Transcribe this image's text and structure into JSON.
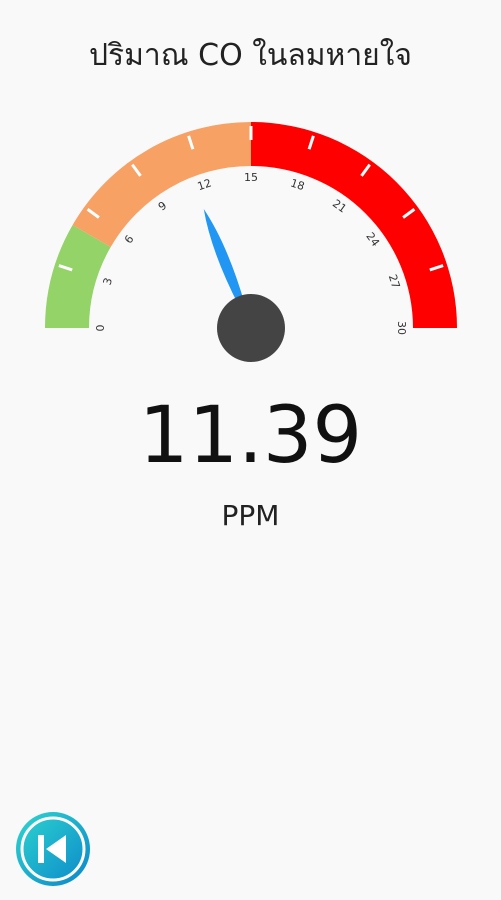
{
  "screen": {
    "title": "ปริมาณ CO ในลมหายใจ"
  },
  "gauge": {
    "min": 0,
    "max": 30,
    "value": 11.39,
    "ticks": [
      "0",
      "3",
      "6",
      "9",
      "12",
      "15",
      "18",
      "21",
      "24",
      "27",
      "30"
    ],
    "zones": [
      {
        "from": 0,
        "to": 5,
        "color": "#93d367"
      },
      {
        "from": 5,
        "to": 15,
        "color": "#f7a164"
      },
      {
        "from": 15,
        "to": 30,
        "color": "#ff0000"
      }
    ],
    "needle_color": "#2196f3",
    "hub_color": "#444444"
  },
  "reading": {
    "value": "11.39",
    "unit": "PPM"
  },
  "navigation": {
    "back_icon": "skip-back-icon",
    "accent": "#1aa6d8"
  }
}
